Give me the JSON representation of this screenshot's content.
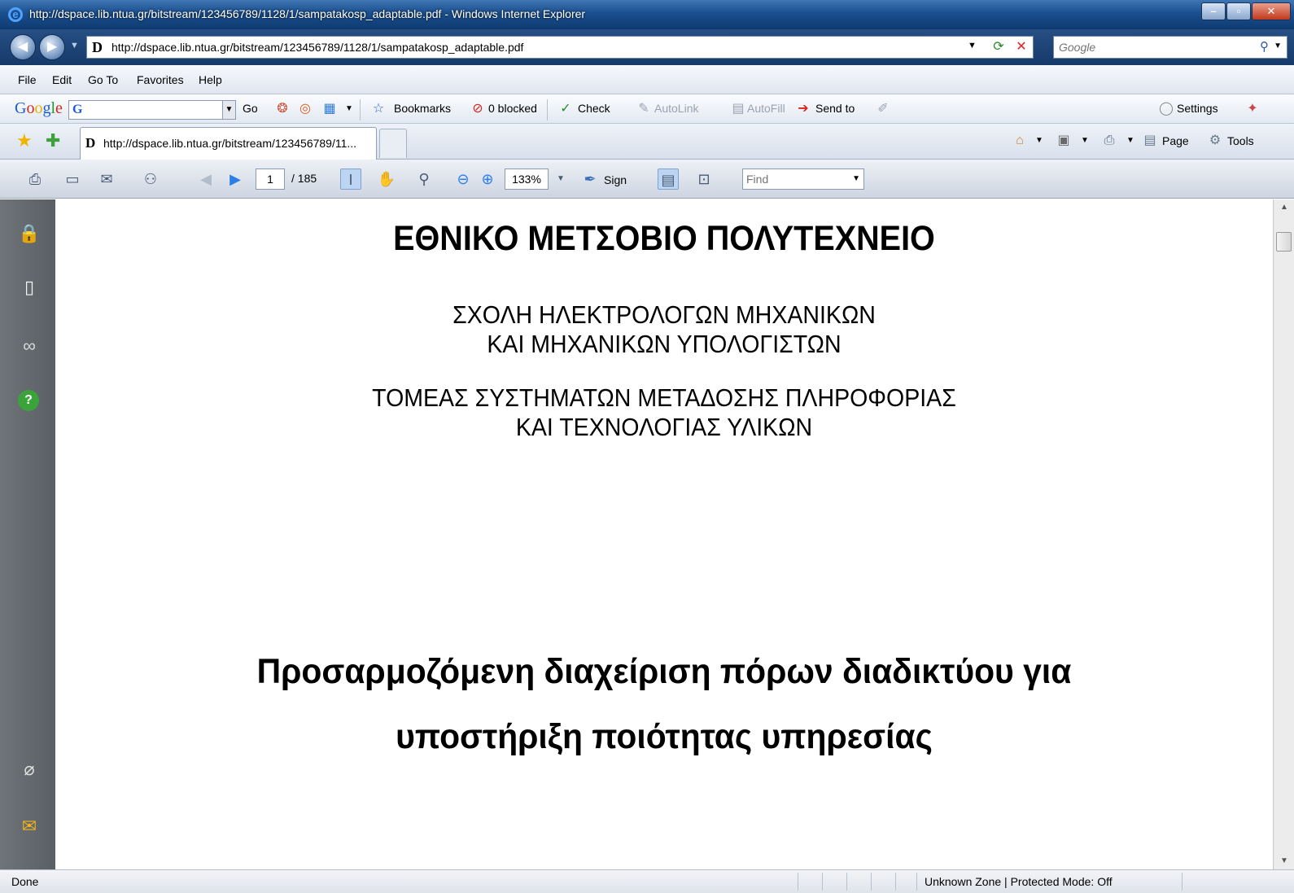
{
  "window": {
    "title": "http://dspace.lib.ntua.gr/bitstream/123456789/1128/1/sampatakosp_adaptable.pdf - Windows Internet Explorer"
  },
  "address": {
    "url": "http://dspace.lib.ntua.gr/bitstream/123456789/1128/1/sampatakosp_adaptable.pdf",
    "search_placeholder": "Google"
  },
  "menu": {
    "file": "File",
    "edit": "Edit",
    "goto": "Go To",
    "favorites": "Favorites",
    "help": "Help"
  },
  "google_toolbar": {
    "go": "Go",
    "bookmarks": "Bookmarks",
    "blocked": "0 blocked",
    "check": "Check",
    "autolink": "AutoLink",
    "autofill": "AutoFill",
    "send_to": "Send to",
    "settings": "Settings"
  },
  "tabs": {
    "active_tab": "http://dspace.lib.ntua.gr/bitstream/123456789/11..."
  },
  "commands": {
    "page": "Page",
    "tools": "Tools"
  },
  "pdf_toolbar": {
    "current_page": "1",
    "page_count": "/ 185",
    "zoom": "133%",
    "sign": "Sign",
    "find_placeholder": "Find"
  },
  "document": {
    "university": "ΕΘΝΙΚΟ ΜΕΤΣΟΒΙΟ ΠΟΛΥΤΕΧΝΕΙΟ",
    "school_line1": "ΣΧΟΛΗ ΗΛΕΚΤΡΟΛΟΓΩΝ ΜΗΧΑΝΙΚΩΝ",
    "school_line2": "ΚΑΙ ΜΗΧΑΝΙΚΩΝ ΥΠΟΛΟΓΙΣΤΩΝ",
    "dept_line1": "ΤΟΜΕΑΣ ΣΥΣΤΗΜΑΤΩΝ ΜΕΤΑΔΟΣΗΣ ΠΛΗΡΟΦΟΡΙΑΣ",
    "dept_line2": "ΚΑΙ ΤΕΧΝΟΛΟΓΙΑΣ ΥΛΙΚΩΝ",
    "thesis_title_line1": "Προσαρμοζόμενη διαχείριση πόρων διαδικτύου για",
    "thesis_title_line2": "υποστήριξη ποιότητας υπηρεσίας"
  },
  "status": {
    "left": "Done",
    "zone": "Unknown Zone | Protected Mode: Off"
  },
  "icons": {
    "left_pane": [
      "lock-icon",
      "pages-icon",
      "binoculars-icon",
      "help-icon",
      "paperclip-icon",
      "comments-icon"
    ]
  }
}
